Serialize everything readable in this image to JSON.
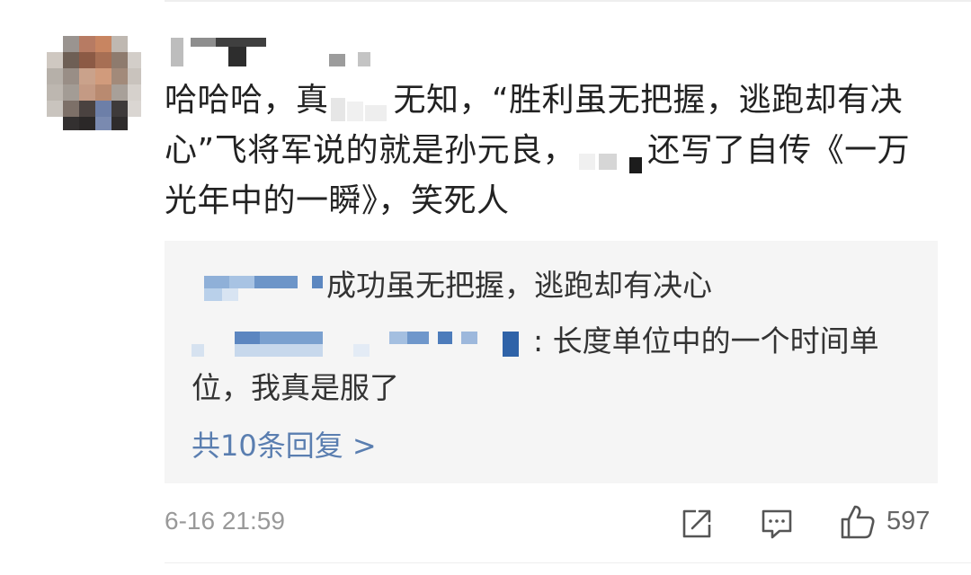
{
  "comment": {
    "text_part1": "哈哈哈，真",
    "text_part2": "无知，“胜利虽无把握，逃跑却有决心”飞将军说的就是孙元良，",
    "text_part3": "还写了自传《一万光年中的一瞬》，笑死人"
  },
  "replies": [
    {
      "text": "成功虽无把握，逃跑却有决心"
    },
    {
      "separator": ":",
      "text_line1": " 长度单位中的一个时间单",
      "text_line2": "位，我真是服了"
    }
  ],
  "more_replies_label": "共10条回复 >",
  "footer": {
    "timestamp": "6-16 21:59",
    "like_count": "597"
  },
  "colors": {
    "link_blue": "#5a7eb0",
    "reply_bg": "#f5f5f5",
    "text_main": "#222222",
    "text_muted": "#999999"
  },
  "icons": {
    "forward": "share-forward-icon",
    "comment": "comment-bubble-icon",
    "like": "thumbs-up-icon"
  }
}
